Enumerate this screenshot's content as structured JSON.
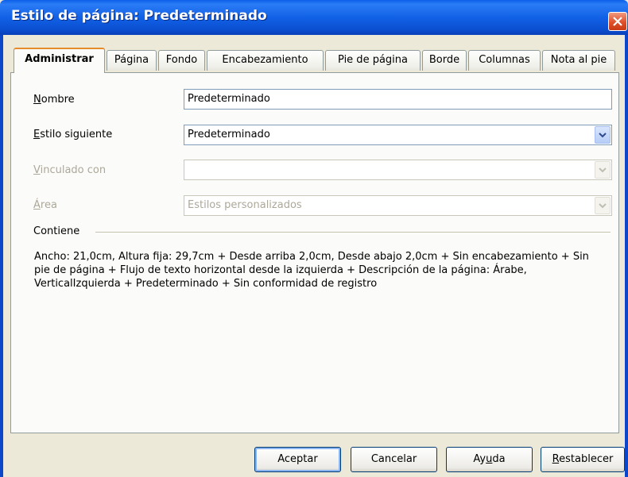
{
  "window": {
    "title": "Estilo de página: Predeterminado"
  },
  "tabs": [
    "Administrar",
    "Página",
    "Fondo",
    "Encabezamiento",
    "Pie de página",
    "Borde",
    "Columnas",
    "Nota al pie"
  ],
  "form": {
    "name": {
      "label_key": "N",
      "label_rest": "ombre",
      "value": "Predeterminado"
    },
    "next_style": {
      "label_key": "E",
      "label_rest": "stilo siguiente",
      "value": "Predeterminado"
    },
    "linked_with": {
      "label_key": "V",
      "label_rest": "inculado con",
      "value": ""
    },
    "area": {
      "label_key": "Á",
      "label_rest": "rea",
      "value": "Estilos personalizados"
    }
  },
  "contains": {
    "label": "Contiene",
    "text": "Ancho: 21,0cm, Altura fija: 29,7cm + Desde arriba 2,0cm, Desde abajo 2,0cm + Sin encabezamiento + Sin pie de página + Flujo de texto horizontal desde la izquierda + Descripción de la página:  Árabe, VerticalIzquierda + Predeterminado + Sin conformidad de registro"
  },
  "buttons": {
    "ok": "Aceptar",
    "cancel": "Cancelar",
    "help_a": "Ay",
    "help_key": "u",
    "help_b": "da",
    "reset_key": "R",
    "reset_rest": "establecer"
  },
  "colors": {
    "titlebar": "#0a5fe8",
    "dialog_bg": "#ece9d8",
    "active_tab_accent": "#e68b2c",
    "close_button": "#e0502a"
  }
}
